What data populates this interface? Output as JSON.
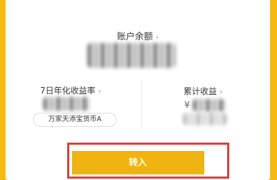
{
  "balance": {
    "label": "账户余额",
    "chevron": "›"
  },
  "yield7d": {
    "label": "7日年化收益率",
    "chevron": "›",
    "fund_name": "万家天添宝货币A"
  },
  "cumulative": {
    "label": "累计收益",
    "chevron": "›",
    "currency_prefix": "¥"
  },
  "transfer_button": {
    "label": "转入",
    "fill_fraction": 0.86
  },
  "colors": {
    "background": "#f5bb12",
    "button": "#f0b40f",
    "highlight": "#e53935"
  }
}
